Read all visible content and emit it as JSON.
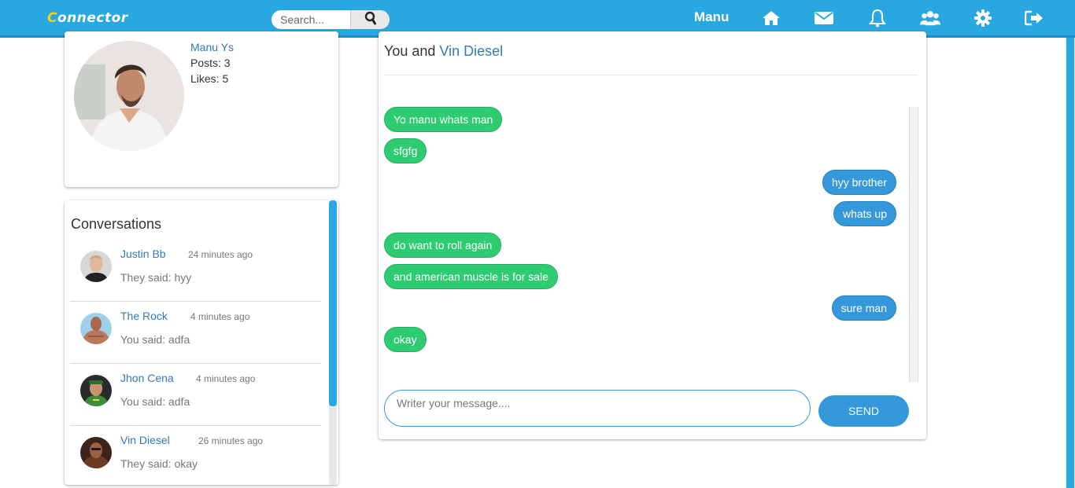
{
  "app": {
    "logo_first": "C",
    "logo_rest": "onnector",
    "search_placeholder": "Search...",
    "username": "Manu",
    "nav_icons": [
      "home-icon",
      "envelope-icon",
      "bell-icon",
      "users-icon",
      "gear-icon",
      "sign-out-icon"
    ],
    "colors": {
      "topbar": "#29a7e1",
      "incoming": "#2ecc71",
      "outgoing": "#3498db",
      "link": "#337ab7"
    }
  },
  "profile": {
    "name": "Manu Ys",
    "posts": "Posts: 3",
    "likes": "Likes: 5"
  },
  "conversations": {
    "title": "Conversations",
    "items": [
      {
        "name": "Justin Bb",
        "time": "24 minutes ago",
        "message": "They said: hyy"
      },
      {
        "name": "The Rock",
        "time": "4 minutes ago",
        "message": "You said: adfa"
      },
      {
        "name": "Jhon Cena",
        "time": "4 minutes ago",
        "message": "You said: adfa"
      },
      {
        "name": "Vin Diesel",
        "time": "26 minutes ago",
        "message": "They said: okay"
      }
    ]
  },
  "chat": {
    "header_prefix": "You and ",
    "partner": "Vin Diesel",
    "messages": [
      {
        "text": "Yo manu whats man",
        "direction": "incoming"
      },
      {
        "text": "sfgfg",
        "direction": "incoming"
      },
      {
        "text": "hyy brother",
        "direction": "outgoing"
      },
      {
        "text": "whats up",
        "direction": "outgoing"
      },
      {
        "text": "do want to roll again",
        "direction": "incoming"
      },
      {
        "text": "and american muscle is for sale",
        "direction": "incoming"
      },
      {
        "text": "sure man",
        "direction": "outgoing"
      },
      {
        "text": "okay",
        "direction": "incoming"
      }
    ],
    "input_placeholder": "Writer your message....",
    "send_label": "SEND"
  }
}
